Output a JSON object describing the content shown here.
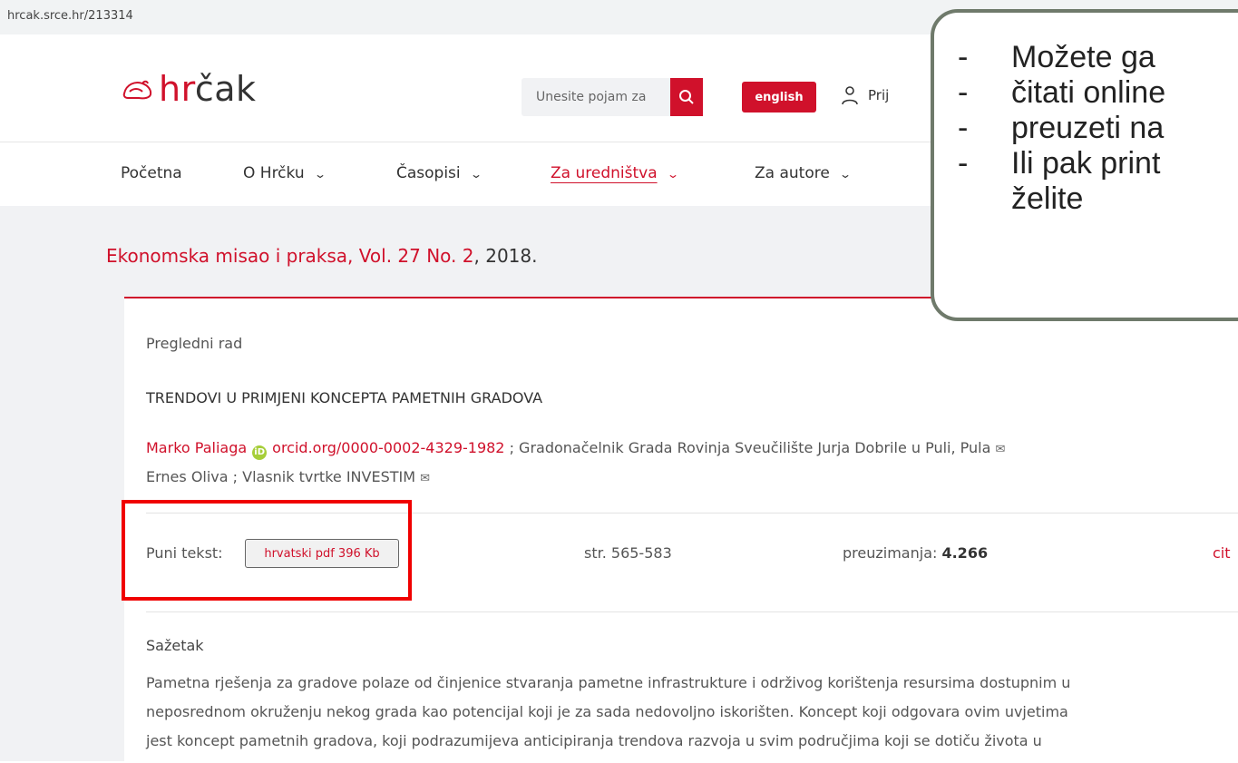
{
  "browser": {
    "url": "hrcak.srce.hr/213314"
  },
  "header": {
    "logo_text_h": "hr",
    "logo_text_rest": "čak",
    "search_placeholder": "Unesite pojam za",
    "language_button": "english",
    "login_label": "Prij",
    "icons": [
      "hamster-logo-icon",
      "search-icon",
      "user-icon"
    ]
  },
  "nav": {
    "items": [
      {
        "label": "Početna",
        "dropdown": false
      },
      {
        "label": "O Hrčku",
        "dropdown": true
      },
      {
        "label": "Časopisi",
        "dropdown": true
      },
      {
        "label": "Za uredništva",
        "dropdown": true,
        "active": true
      },
      {
        "label": "Za autore",
        "dropdown": true
      }
    ],
    "chevron": "⌄"
  },
  "issue": {
    "journal_link": "Ekonomska misao i praksa, Vol. 27 No. 2",
    "year": ", 2018."
  },
  "article": {
    "type": "Pregledni rad",
    "title": "TRENDOVI U PRIMJENI KONCEPTA PAMETNIH GRADOVA",
    "author1_name": "Marko Paliaga",
    "author1_orcid": "orcid.org/0000-0002-4329-1982",
    "author1_affiliation": " ; Gradonačelnik Grada Rovinja Sveučilište Jurja Dobrile u Puli, Pula",
    "author2": "Ernes Oliva ; Vlasnik tvrtke INVESTIM",
    "full_text_label": "Puni tekst:",
    "pdf_button": "hrvatski pdf 396 Kb",
    "pages": "str. 565-583",
    "downloads_label": "preuzimanja: ",
    "downloads_count": "4.266",
    "cite_label": "cit",
    "abstract_heading": "Sažetak",
    "abstract_lines": [
      "Pametna rješenja za gradove polaze od činjenice stvaranja pametne infrastrukture i održivog korištenja resursima dostupnim u",
      "neposrednom okruženju nekog grada kao potencijal koji je za sada nedovoljno iskorišten. Koncept koji odgovara ovim uvjetima",
      "jest koncept pametnih gradova, koji podrazumijeva anticipiranja trendova razvoja u svim područjima koji se dotiču života u"
    ]
  },
  "callout": {
    "items": [
      {
        "dash": "-",
        "text": "Možete ga"
      },
      {
        "dash": "-",
        "text": "čitati online"
      },
      {
        "dash": "-",
        "text": "preuzeti na"
      },
      {
        "dash": "-",
        "text": "Ili pak print",
        "continuation": "želite"
      }
    ]
  },
  "colors": {
    "brand_red": "#d0112b",
    "highlight_red": "#f00000",
    "callout_border": "#6f7a6b",
    "page_gray": "#f1f2f4"
  }
}
